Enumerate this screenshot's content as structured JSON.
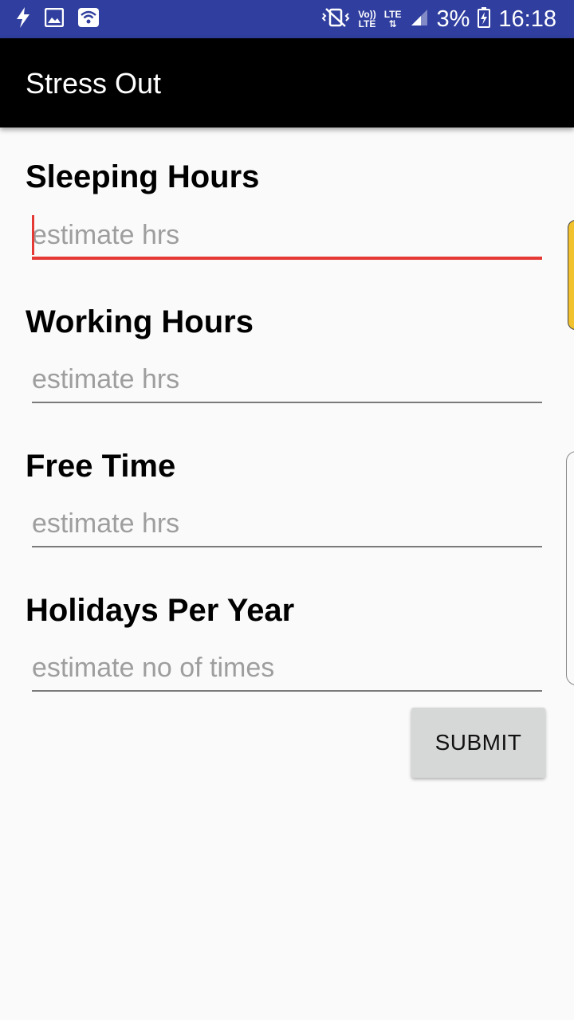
{
  "status_bar": {
    "background": "#303f9f",
    "left_icons": [
      "flash-icon",
      "image-icon",
      "wifi-icon"
    ],
    "volte_label_top": "Vo))",
    "volte_label_bottom": "LTE",
    "lte_label": "LTE",
    "battery_percent": "3%",
    "time": "16:18"
  },
  "toolbar": {
    "title": "Stress Out",
    "background": "#000000"
  },
  "form": {
    "fields": [
      {
        "label": "Sleeping Hours",
        "placeholder": "estimate hrs",
        "value": "",
        "focused": true
      },
      {
        "label": "Working Hours",
        "placeholder": "estimate hrs",
        "value": "",
        "focused": false
      },
      {
        "label": "Free Time",
        "placeholder": "estimate hrs",
        "value": "",
        "focused": false
      },
      {
        "label": "Holidays Per Year",
        "placeholder": "estimate no of times",
        "value": "",
        "focused": false
      }
    ],
    "submit_label": "SUBMIT"
  },
  "colors": {
    "accent": "#e53935",
    "page_background": "#fafafa",
    "button_background": "#d6d7d7",
    "edge_tab": "#f2c12e"
  }
}
